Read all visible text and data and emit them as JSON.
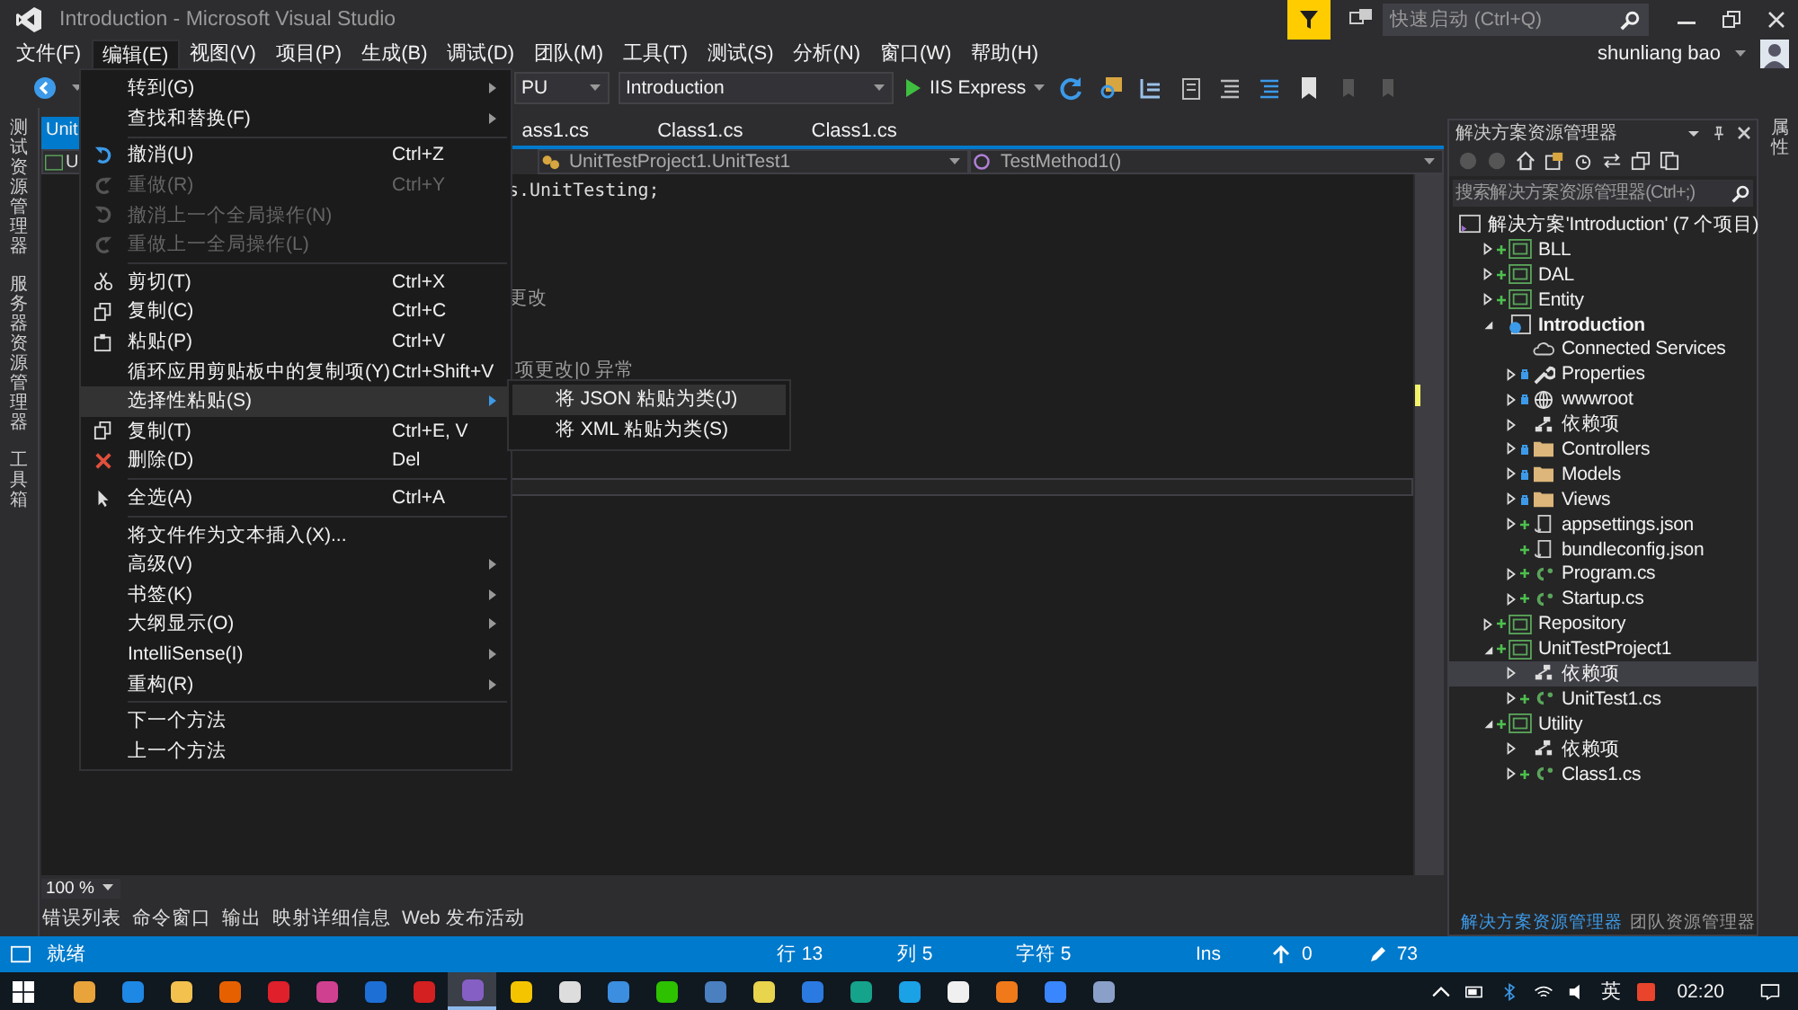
{
  "window": {
    "title": "Introduction - Microsoft Visual Studio",
    "quick_launch": {
      "placeholder": "快速启动 (Ctrl+Q)"
    }
  },
  "menu_bar": {
    "items": [
      {
        "label": "文件(F)",
        "selected": false
      },
      {
        "label": "编辑(E)",
        "selected": true
      },
      {
        "label": "视图(V)",
        "selected": false
      },
      {
        "label": "项目(P)",
        "selected": false
      },
      {
        "label": "生成(B)",
        "selected": false
      },
      {
        "label": "调试(D)",
        "selected": false
      },
      {
        "label": "团队(M)",
        "selected": false
      },
      {
        "label": "工具(T)",
        "selected": false
      },
      {
        "label": "测试(S)",
        "selected": false
      },
      {
        "label": "分析(N)",
        "selected": false
      },
      {
        "label": "窗口(W)",
        "selected": false
      },
      {
        "label": "帮助(H)",
        "selected": false
      }
    ],
    "user": "shunliang bao"
  },
  "toolbar": {
    "platform": "PU",
    "startup_project": "Introduction",
    "run_target": "IIS Express"
  },
  "left_strip": [
    "测试资源管理器",
    "服务器资源管理器",
    "工具箱"
  ],
  "editor": {
    "tabs": [
      {
        "label": "Unit",
        "selected": true
      },
      {
        "label": "ass1.cs",
        "selected": false
      },
      {
        "label": "Class1.cs",
        "selected": false
      },
      {
        "label": "Class1.cs",
        "selected": false
      }
    ],
    "nav": {
      "project": "U",
      "class": "UnitTestProject1.UnitTest1",
      "member": "TestMethod1()"
    },
    "lines": [
      {
        "kind": "code",
        "text": "s.UnitTesting;"
      },
      {
        "kind": "lens",
        "text": "更改"
      },
      {
        "kind": "lens",
        "text": "项更改|0 异常"
      }
    ],
    "zoom": "100 %"
  },
  "edit_menu": {
    "items": [
      {
        "kind": "plain",
        "label": "转到(G)",
        "submenu": true,
        "disabled": false,
        "selected": false
      },
      {
        "kind": "plain",
        "label": "查找和替换(F)",
        "submenu": true,
        "disabled": false,
        "selected": false
      },
      {
        "kind": "separator"
      },
      {
        "kind": "undo",
        "label": "撤消(U)",
        "shortcut": "Ctrl+Z",
        "submenu": false,
        "disabled": false,
        "selected": false
      },
      {
        "kind": "redo",
        "label": "重做(R)",
        "shortcut": "Ctrl+Y",
        "submenu": false,
        "disabled": true,
        "selected": false
      },
      {
        "kind": "undo",
        "label": "撤消上一个全局操作(N)",
        "submenu": false,
        "disabled": true,
        "selected": false
      },
      {
        "kind": "redo",
        "label": "重做上一全局操作(L)",
        "submenu": false,
        "disabled": true,
        "selected": false
      },
      {
        "kind": "separator"
      },
      {
        "kind": "cut",
        "label": "剪切(T)",
        "shortcut": "Ctrl+X",
        "submenu": false,
        "disabled": false,
        "selected": false
      },
      {
        "kind": "copy",
        "label": "复制(C)",
        "shortcut": "Ctrl+C",
        "submenu": false,
        "disabled": false,
        "selected": false
      },
      {
        "kind": "paste",
        "label": "粘贴(P)",
        "shortcut": "Ctrl+V",
        "submenu": false,
        "disabled": false,
        "selected": false
      },
      {
        "kind": "plain",
        "label": "循环应用剪贴板中的复制项(Y)",
        "shortcut": "Ctrl+Shift+V",
        "submenu": false,
        "disabled": false,
        "selected": false
      },
      {
        "kind": "plain",
        "label": "选择性粘贴(S)",
        "submenu": true,
        "disabled": false,
        "selected": true
      },
      {
        "kind": "copy",
        "label": "复制(T)",
        "shortcut": "Ctrl+E, V",
        "submenu": false,
        "disabled": false,
        "selected": false
      },
      {
        "kind": "delete",
        "label": "删除(D)",
        "shortcut": "Del",
        "submenu": false,
        "disabled": false,
        "selected": false
      },
      {
        "kind": "separator"
      },
      {
        "kind": "select",
        "label": "全选(A)",
        "shortcut": "Ctrl+A",
        "submenu": false,
        "disabled": false,
        "selected": false
      },
      {
        "kind": "separator"
      },
      {
        "kind": "plain",
        "label": "将文件作为文本插入(X)...",
        "submenu": false,
        "disabled": false,
        "selected": false
      },
      {
        "kind": "plain",
        "label": "高级(V)",
        "submenu": true,
        "disabled": false,
        "selected": false
      },
      {
        "kind": "plain",
        "label": "书签(K)",
        "submenu": true,
        "disabled": false,
        "selected": false
      },
      {
        "kind": "plain",
        "label": "大纲显示(O)",
        "submenu": true,
        "disabled": false,
        "selected": false
      },
      {
        "kind": "plain",
        "label": "IntelliSense(I)",
        "submenu": true,
        "disabled": false,
        "selected": false
      },
      {
        "kind": "plain",
        "label": "重构(R)",
        "submenu": true,
        "disabled": false,
        "selected": false
      },
      {
        "kind": "separator"
      },
      {
        "kind": "plain",
        "label": "下一个方法",
        "submenu": false,
        "disabled": false,
        "selected": false
      },
      {
        "kind": "plain",
        "label": "上一个方法",
        "submenu": false,
        "disabled": false,
        "selected": false
      }
    ]
  },
  "paste_special_menu": {
    "items": [
      {
        "label": "将 JSON 粘贴为类(J)",
        "selected": true
      },
      {
        "label": "将 XML 粘贴为类(S)",
        "selected": false
      }
    ]
  },
  "solution_explorer": {
    "title": "解决方案资源管理器",
    "search": {
      "placeholder": "搜索解决方案资源管理器(Ctrl+;)"
    },
    "tree": [
      {
        "label": "解决方案'Introduction' (7 个项目)",
        "kind": "solution",
        "added": false,
        "checked_in": false,
        "selected": false,
        "startup": false,
        "children": [
          {
            "label": "BLL",
            "kind": "cs-project",
            "added": true,
            "checked_in": false,
            "expanded": false,
            "selected": false,
            "startup": false
          },
          {
            "label": "DAL",
            "kind": "cs-project",
            "added": true,
            "checked_in": false,
            "expanded": false,
            "selected": false,
            "startup": false
          },
          {
            "label": "Entity",
            "kind": "cs-project",
            "added": true,
            "checked_in": false,
            "expanded": false,
            "selected": false,
            "startup": false
          },
          {
            "label": "Introduction",
            "kind": "web-project",
            "added": false,
            "checked_in": false,
            "expanded": true,
            "selected": false,
            "startup": true,
            "children": [
              {
                "label": "Connected Services",
                "kind": "cloud",
                "added": false,
                "checked_in": false,
                "selected": false,
                "startup": false
              },
              {
                "label": "Properties",
                "kind": "wrench",
                "added": false,
                "checked_in": true,
                "expanded": false,
                "selected": false,
                "startup": false
              },
              {
                "label": "wwwroot",
                "kind": "globe",
                "added": false,
                "checked_in": true,
                "expanded": false,
                "selected": false,
                "startup": false
              },
              {
                "label": "依赖项",
                "kind": "deps",
                "added": false,
                "checked_in": false,
                "expanded": false,
                "selected": false,
                "startup": false
              },
              {
                "label": "Controllers",
                "kind": "folder",
                "added": false,
                "checked_in": true,
                "expanded": false,
                "selected": false,
                "startup": false
              },
              {
                "label": "Models",
                "kind": "folder",
                "added": false,
                "checked_in": true,
                "expanded": false,
                "selected": false,
                "startup": false
              },
              {
                "label": "Views",
                "kind": "folder",
                "added": false,
                "checked_in": true,
                "expanded": false,
                "selected": false,
                "startup": false
              },
              {
                "label": "appsettings.json",
                "kind": "json",
                "added": true,
                "checked_in": false,
                "expanded": false,
                "selected": false,
                "startup": false
              },
              {
                "label": "bundleconfig.json",
                "kind": "json",
                "added": true,
                "checked_in": false,
                "selected": false,
                "startup": false
              },
              {
                "label": "Program.cs",
                "kind": "cs-file",
                "added": true,
                "checked_in": false,
                "expanded": false,
                "selected": false,
                "startup": false
              },
              {
                "label": "Startup.cs",
                "kind": "cs-file",
                "added": true,
                "checked_in": false,
                "expanded": false,
                "selected": false,
                "startup": false
              }
            ]
          },
          {
            "label": "Repository",
            "kind": "cs-project",
            "added": true,
            "checked_in": false,
            "expanded": false,
            "selected": false,
            "startup": false
          },
          {
            "label": "UnitTestProject1",
            "kind": "cs-project",
            "added": true,
            "checked_in": false,
            "expanded": true,
            "selected": false,
            "startup": false,
            "children": [
              {
                "label": "依赖项",
                "kind": "deps",
                "added": false,
                "checked_in": false,
                "expanded": false,
                "selected": true,
                "startup": false
              },
              {
                "label": "UnitTest1.cs",
                "kind": "cs-file",
                "added": true,
                "checked_in": false,
                "expanded": false,
                "selected": false,
                "startup": false
              }
            ]
          },
          {
            "label": "Utility",
            "kind": "cs-project",
            "added": true,
            "checked_in": false,
            "expanded": true,
            "selected": false,
            "startup": false,
            "children": [
              {
                "label": "依赖项",
                "kind": "deps",
                "added": false,
                "checked_in": false,
                "expanded": false,
                "selected": false,
                "startup": false
              },
              {
                "label": "Class1.cs",
                "kind": "cs-file",
                "added": true,
                "checked_in": false,
                "expanded": false,
                "selected": false,
                "startup": false
              }
            ]
          }
        ]
      }
    ],
    "tabs": [
      {
        "label": "解决方案资源管理器",
        "selected": true
      },
      {
        "label": "团队资源管理器",
        "selected": false
      }
    ]
  },
  "right_strip": [
    "属性"
  ],
  "tool_tabs": [
    "错误列表",
    "命令窗口",
    "输出",
    "映射详细信息",
    "Web 发布活动"
  ],
  "status_bar": {
    "message": "就绪",
    "line": "行 13",
    "column": "列 5",
    "char": "字符 5",
    "mode": "Ins",
    "pushes": "0",
    "changes": "73"
  },
  "taskbar": {
    "apps": [
      {
        "color": "#e8a33a",
        "active": false
      },
      {
        "color": "#1e88e5",
        "active": false
      },
      {
        "color": "#f2c14e",
        "active": false
      },
      {
        "color": "#e66000",
        "active": false
      },
      {
        "color": "#e0202a",
        "active": false
      },
      {
        "color": "#d04090",
        "active": false
      },
      {
        "color": "#1d6fd6",
        "active": false
      },
      {
        "color": "#d42020",
        "active": false
      },
      {
        "color": "#865fc5",
        "active": true
      },
      {
        "color": "#f5c400",
        "active": false
      },
      {
        "color": "#dddddd",
        "active": false
      },
      {
        "color": "#3b8ee0",
        "active": false
      },
      {
        "color": "#2dc100",
        "active": false
      },
      {
        "color": "#4a7fc0",
        "active": false
      },
      {
        "color": "#e8d44d",
        "active": false
      },
      {
        "color": "#2a7ae2",
        "active": false
      },
      {
        "color": "#15a38b",
        "active": false
      },
      {
        "color": "#1aa1e6",
        "active": false
      },
      {
        "color": "#f0f0f0",
        "active": false
      },
      {
        "color": "#f07a1a",
        "active": false
      },
      {
        "color": "#3a86ff",
        "active": false
      },
      {
        "color": "#8aa0c8",
        "active": false
      }
    ],
    "ime": "英",
    "time": "02:20"
  }
}
